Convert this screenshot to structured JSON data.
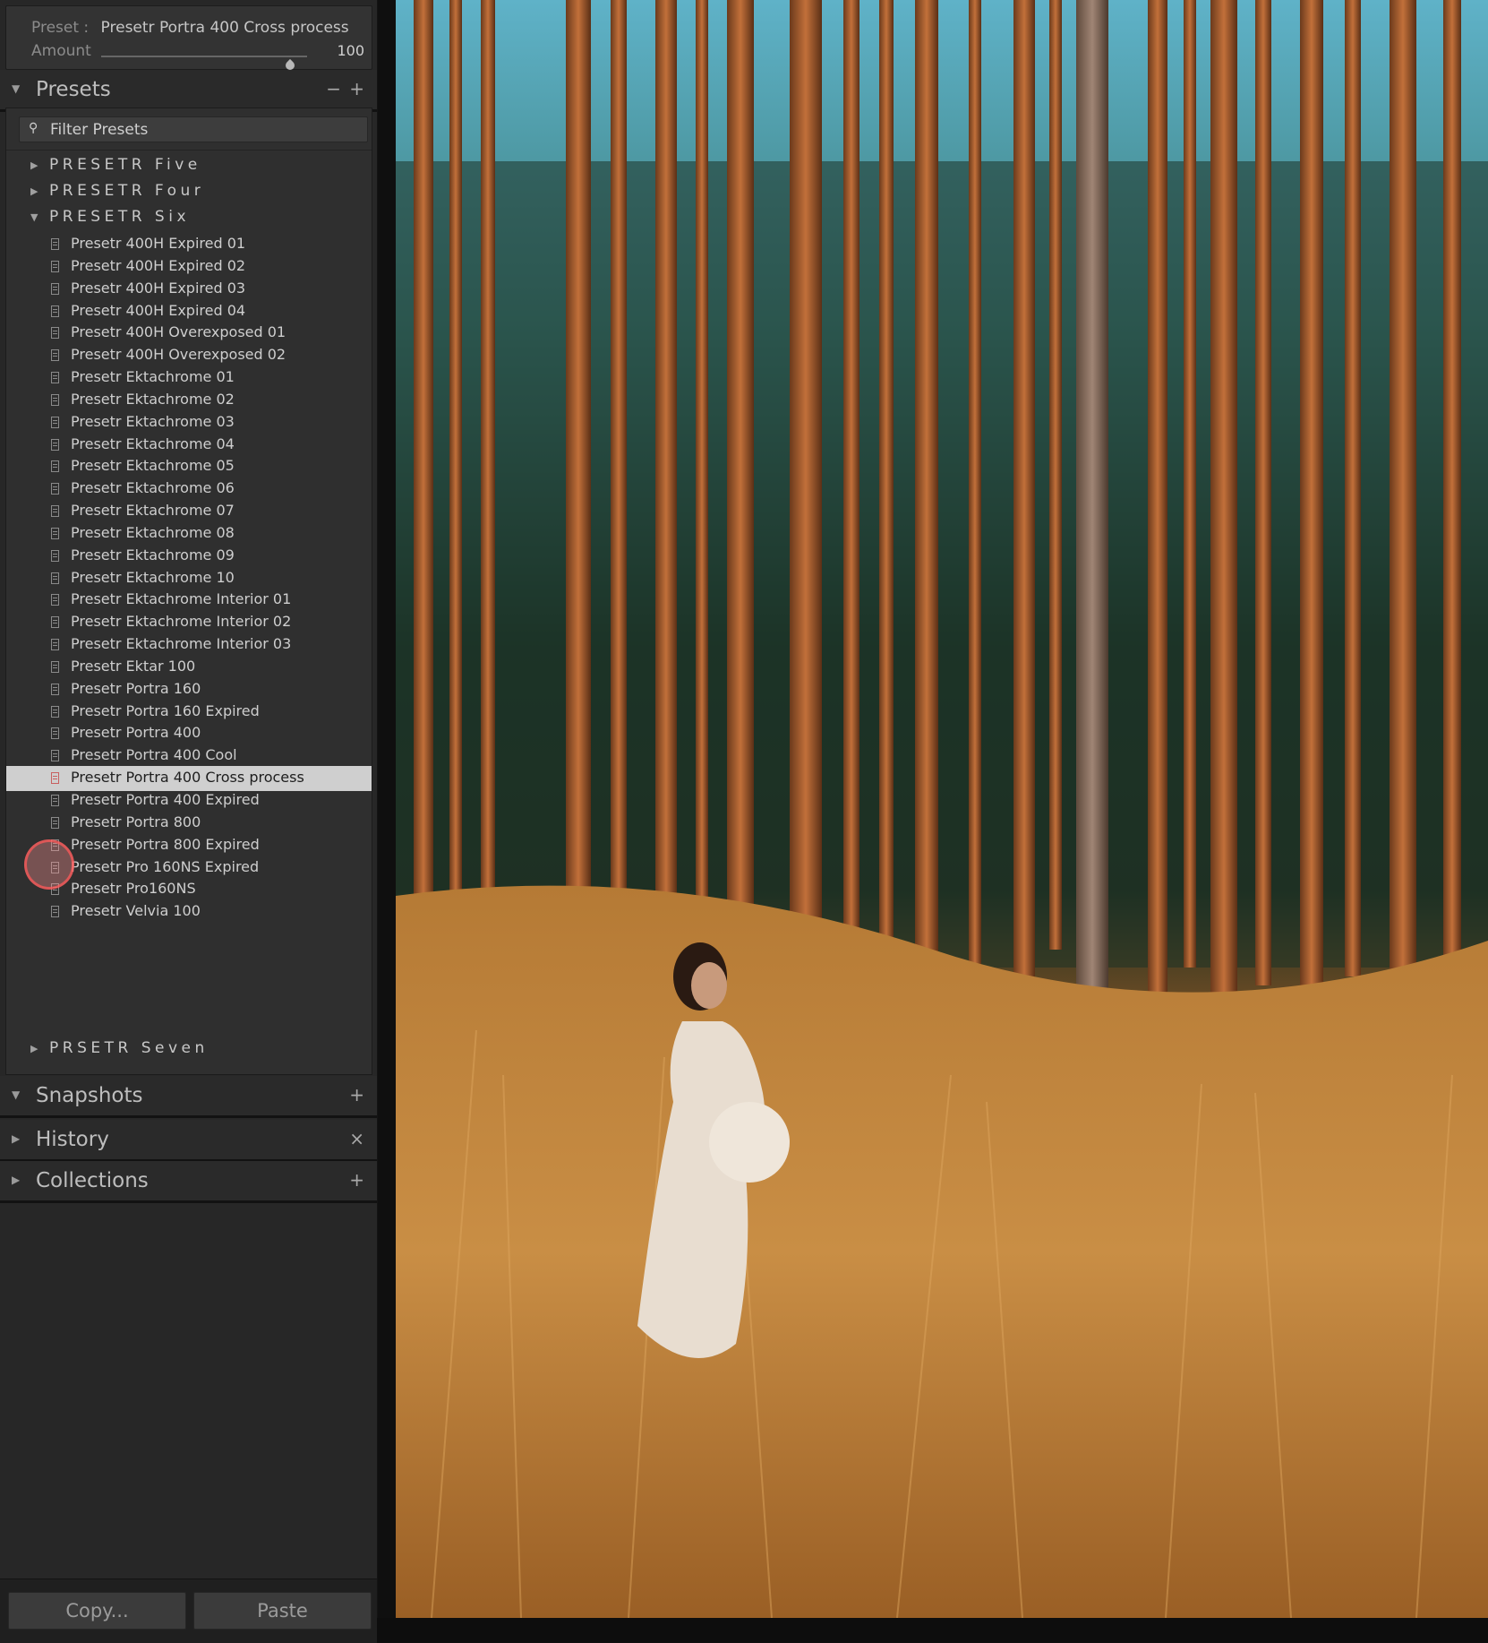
{
  "preset_bar": {
    "preset_label": "Preset :",
    "preset_value": "Presetr Portra 400 Cross process",
    "amount_label": "Amount",
    "amount_value": "100"
  },
  "presets_section": {
    "title": "Presets",
    "minus_icon": "minus-icon",
    "plus_icon": "plus-icon",
    "filter_placeholder": "Filter Presets",
    "folders": [
      {
        "name": "PRESETR Five",
        "expanded": false
      },
      {
        "name": "PRESETR Four",
        "expanded": false
      },
      {
        "name": "PRESETR Six",
        "expanded": true
      },
      {
        "name": "PRSETR Seven",
        "expanded": false
      }
    ],
    "items": [
      "Presetr 400H Expired 01",
      "Presetr 400H Expired 02",
      "Presetr 400H Expired 03",
      "Presetr 400H Expired 04",
      "Presetr 400H Overexposed 01",
      "Presetr 400H Overexposed 02",
      "Presetr Ektachrome 01",
      "Presetr Ektachrome 02",
      "Presetr Ektachrome 03",
      "Presetr Ektachrome 04",
      "Presetr Ektachrome 05",
      "Presetr Ektachrome 06",
      "Presetr Ektachrome 07",
      "Presetr Ektachrome 08",
      "Presetr Ektachrome 09",
      "Presetr Ektachrome 10",
      "Presetr Ektachrome Interior 01",
      "Presetr Ektachrome Interior 02",
      "Presetr Ektachrome Interior 03",
      "Presetr Ektar 100",
      "Presetr Portra 160",
      "Presetr Portra 160 Expired",
      "Presetr Portra 400",
      "Presetr Portra 400 Cool",
      "Presetr Portra 400 Cross process",
      "Presetr Portra 400 Expired",
      "Presetr Portra 800",
      "Presetr Portra 800 Expired",
      "Presetr Pro 160NS Expired",
      "Presetr Pro160NS",
      "Presetr Velvia 100"
    ],
    "selected_item": "Presetr Portra 400 Cross process"
  },
  "snapshots": {
    "title": "Snapshots"
  },
  "history": {
    "title": "History"
  },
  "collections": {
    "title": "Collections"
  },
  "buttons": {
    "copy": "Copy...",
    "paste": "Paste"
  },
  "photo": {
    "description_icon": "photo-preview"
  }
}
